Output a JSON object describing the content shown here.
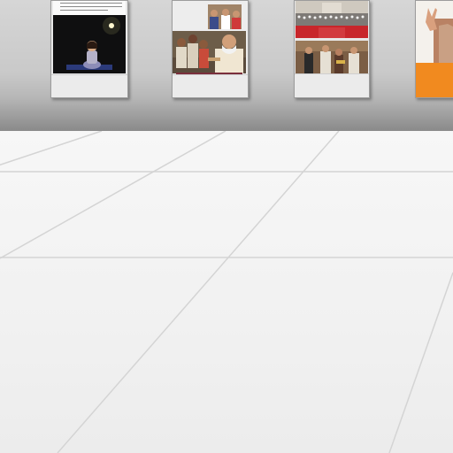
{
  "scene": {
    "panels": [
      {
        "name": "panel-girl-night-photo",
        "caption_lines": 3
      },
      {
        "name": "panel-children-group-photo"
      },
      {
        "name": "panel-ceremony-photo"
      },
      {
        "name": "panel-orange-poster"
      }
    ]
  },
  "colors": {
    "wall": "#c6c6c6",
    "floor": "#f2f2f2",
    "panel_frame": "#e9e9e9",
    "accent_orange": "#f18a1f",
    "ceremony_red": "#c8262b"
  }
}
